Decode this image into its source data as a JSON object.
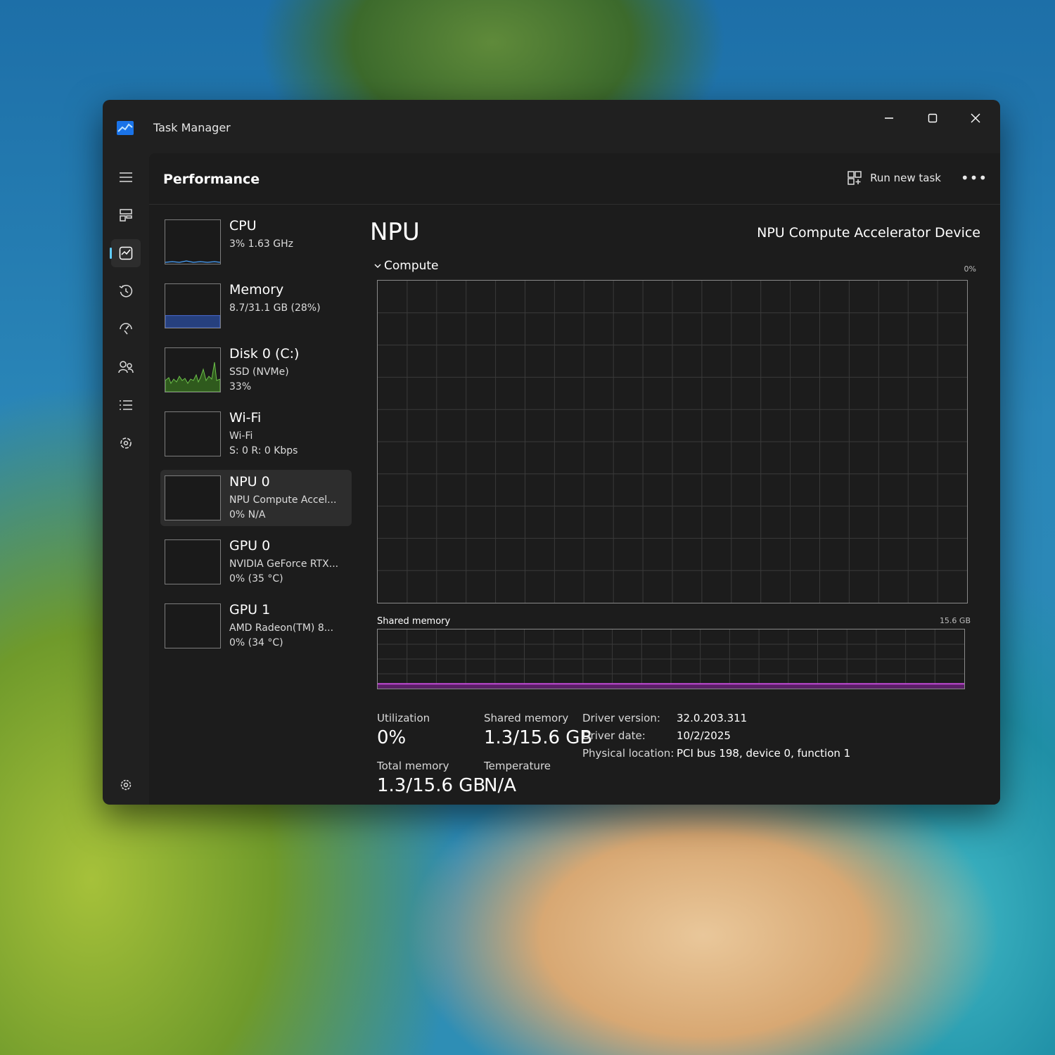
{
  "window": {
    "title": "Task Manager"
  },
  "nav": {
    "items": [
      "menu-icon",
      "processes-icon",
      "performance-icon",
      "app-history-icon",
      "startup-apps-icon",
      "users-icon",
      "details-icon",
      "services-icon",
      "settings-icon"
    ],
    "active": "performance-icon",
    "accent": "#60cdff"
  },
  "header": {
    "title": "Performance",
    "run_task_label": "Run new task",
    "more_label": "•••"
  },
  "devices": [
    {
      "name": "CPU",
      "line2": "3%  1.63 GHz",
      "line3": "",
      "graph_color": "#4aa3ff"
    },
    {
      "name": "Memory",
      "line2": "8.7/31.1 GB (28%)",
      "line3": "",
      "graph_color": "#4a6cd4",
      "fill_fraction": 0.28
    },
    {
      "name": "Disk 0 (C:)",
      "line2": "SSD (NVMe)",
      "line3": "33%",
      "graph_color": "#6cc04a"
    },
    {
      "name": "Wi-Fi",
      "line2": "Wi-Fi",
      "line3": "S: 0 R: 0 Kbps",
      "graph_color": "#c46fd6"
    },
    {
      "name": "NPU 0",
      "line2": "NPU Compute Accel...",
      "line3": "0% N/A",
      "graph_color": "#c46fd6",
      "selected": true
    },
    {
      "name": "GPU 0",
      "line2": "NVIDIA GeForce RTX...",
      "line3": "0% (35 °C)",
      "graph_color": "#4aa3ff"
    },
    {
      "name": "GPU 1",
      "line2": "AMD Radeon(TM) 8...",
      "line3": "0% (34 °C)",
      "graph_color": "#4aa3ff"
    }
  ],
  "detail": {
    "title": "NPU",
    "device_name": "NPU Compute Accelerator Device",
    "compute_label": "Compute",
    "compute_max": "0%",
    "shared_label": "Shared memory",
    "shared_max": "15.6 GB",
    "shared_fill_fraction": 0.08,
    "accent": "#c24ad6",
    "stats": {
      "utilization_label": "Utilization",
      "utilization_value": "0%",
      "shared_memory_label": "Shared memory",
      "shared_memory_value": "1.3/15.6 GB",
      "total_memory_label": "Total memory",
      "total_memory_value": "1.3/15.6 GB",
      "temperature_label": "Temperature",
      "temperature_value": "N/A"
    },
    "info": {
      "driver_version_label": "Driver version:",
      "driver_version_value": "32.0.203.311",
      "driver_date_label": "Driver date:",
      "driver_date_value": "10/2/2025",
      "physical_location_label": "Physical location:",
      "physical_location_value": "PCI bus 198, device 0, function 1"
    }
  }
}
